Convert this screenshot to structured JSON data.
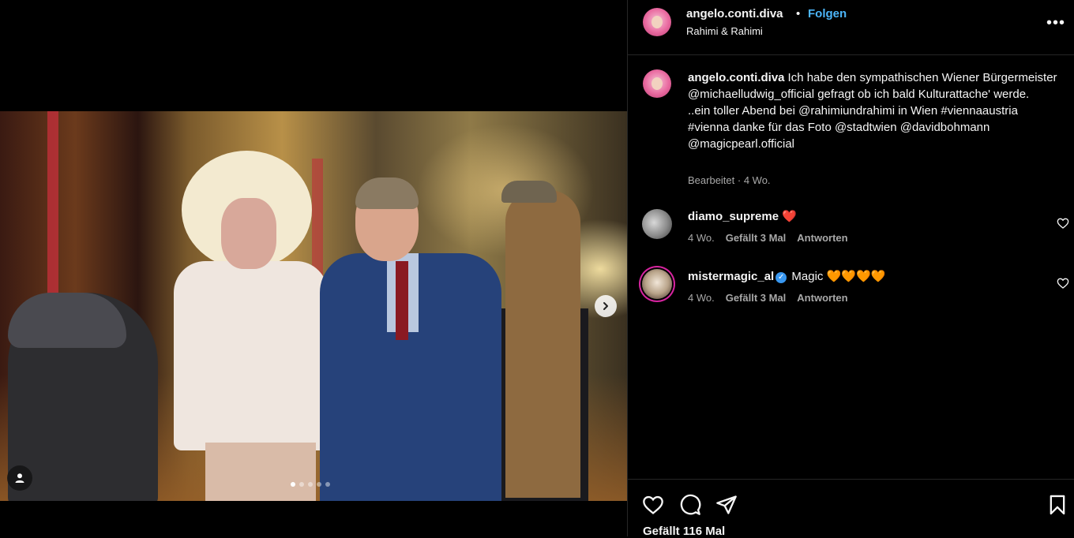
{
  "post": {
    "username": "angelo.conti.diva",
    "separator": "•",
    "follow_label": "Folgen",
    "location": "Rahimi & Rahimi",
    "more_icon": "more-horizontal-icon"
  },
  "caption": {
    "username": "angelo.conti.diva",
    "text": "Ich habe den sympathischen Wiener Bürgermeister @michaelludwig_official gefragt ob ich bald Kulturattache' werde.",
    "text2": "..ein toller Abend bei @rahimiundrahimi in Wien #viennaaustria #vienna danke für das Foto @stadtwien @davidbohmann @magicpearl.official",
    "meta": "Bearbeitet · 4 Wo."
  },
  "comments": [
    {
      "username": "diamo_supreme",
      "text": "❤️",
      "age": "4 Wo.",
      "likes": "Gefällt 3 Mal",
      "reply": "Antworten",
      "verified": false
    },
    {
      "username": "mistermagic_al",
      "text": "Magic 🧡🧡🧡🧡",
      "age": "4 Wo.",
      "likes": "Gefällt 3 Mal",
      "reply": "Antworten",
      "verified": true
    }
  ],
  "media": {
    "slide_count": 5,
    "active_slide": 1
  },
  "actions": {
    "likes_text": "Gefällt 116 Mal"
  },
  "colors": {
    "background": "#000000",
    "text": "#f5f5f5",
    "muted": "#a8a8a8",
    "link_blue": "#4cb5f9",
    "divider": "#262626"
  }
}
